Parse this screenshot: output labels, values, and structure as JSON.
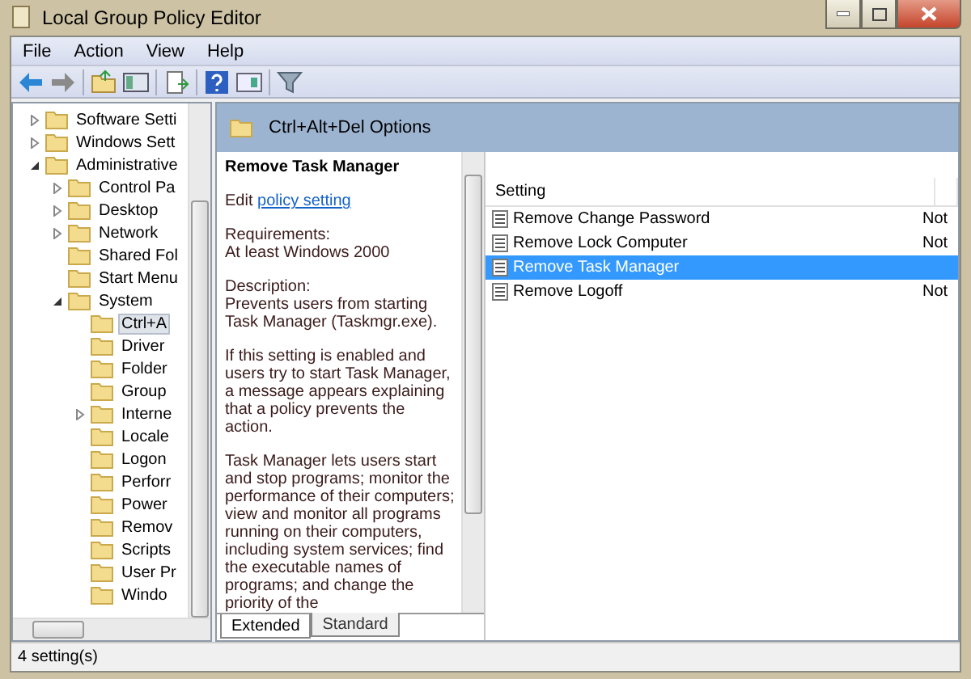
{
  "window": {
    "title": "Local Group Policy Editor"
  },
  "menu": [
    "File",
    "Action",
    "View",
    "Help"
  ],
  "tree": [
    {
      "label": "Software Setti",
      "expanded": false,
      "selected": false
    },
    {
      "label": "Windows Sett",
      "expanded": false,
      "selected": false
    },
    {
      "label": "Administrative",
      "expanded": true,
      "selected": false,
      "children": [
        {
          "label": "Control Pa",
          "expanded": false,
          "selected": false
        },
        {
          "label": "Desktop",
          "expanded": false,
          "selected": false
        },
        {
          "label": "Network",
          "expanded": false,
          "selected": false
        },
        {
          "label": "Shared Fol",
          "selected": false
        },
        {
          "label": "Start Menu",
          "selected": false
        },
        {
          "label": "System",
          "expanded": true,
          "selected": false,
          "children": [
            {
              "label": "Ctrl+A",
              "selected": true
            },
            {
              "label": "Driver",
              "selected": false
            },
            {
              "label": "Folder",
              "selected": false
            },
            {
              "label": "Group",
              "selected": false
            },
            {
              "label": "Interne",
              "expanded": false,
              "selected": false
            },
            {
              "label": "Locale",
              "selected": false
            },
            {
              "label": "Logon",
              "selected": false
            },
            {
              "label": "Perforr",
              "selected": false
            },
            {
              "label": "Power",
              "selected": false
            },
            {
              "label": "Remov",
              "selected": false
            },
            {
              "label": "Scripts",
              "selected": false
            },
            {
              "label": "User Pr",
              "selected": false
            },
            {
              "label": "Windo",
              "selected": false
            }
          ]
        }
      ]
    }
  ],
  "header": {
    "title": "Ctrl+Alt+Del Options"
  },
  "description": {
    "title": "Remove Task Manager",
    "edit_prefix": "Edit",
    "edit_link": "policy setting",
    "requirements_label": "Requirements:",
    "requirements": "At least Windows 2000",
    "description_label": "Description:",
    "paragraphs": [
      "Prevents users from starting Task Manager (Taskmgr.exe).",
      "If this setting is enabled and users try to start Task Manager, a message appears explaining that a policy prevents the action.",
      "Task Manager lets users start and stop programs; monitor the performance of their computers; view and monitor all programs running on their computers, including system services; find the executable names of programs; and change the priority of the"
    ]
  },
  "table": {
    "columns": [
      "Setting",
      ""
    ],
    "rows": [
      {
        "setting": "Remove Change Password",
        "column_2": "Not",
        "selected": false
      },
      {
        "setting": "Remove Lock Computer",
        "column_2": "Not",
        "selected": false
      },
      {
        "setting": "Remove Task Manager",
        "selected": true
      },
      {
        "setting": "Remove Logoff",
        "column_2": "Not",
        "selected": false
      }
    ]
  },
  "tabs": [
    {
      "label": "Extended",
      "selected": true
    },
    {
      "label": "Standard",
      "selected": false
    }
  ],
  "status_bar": "4 setting(s)"
}
